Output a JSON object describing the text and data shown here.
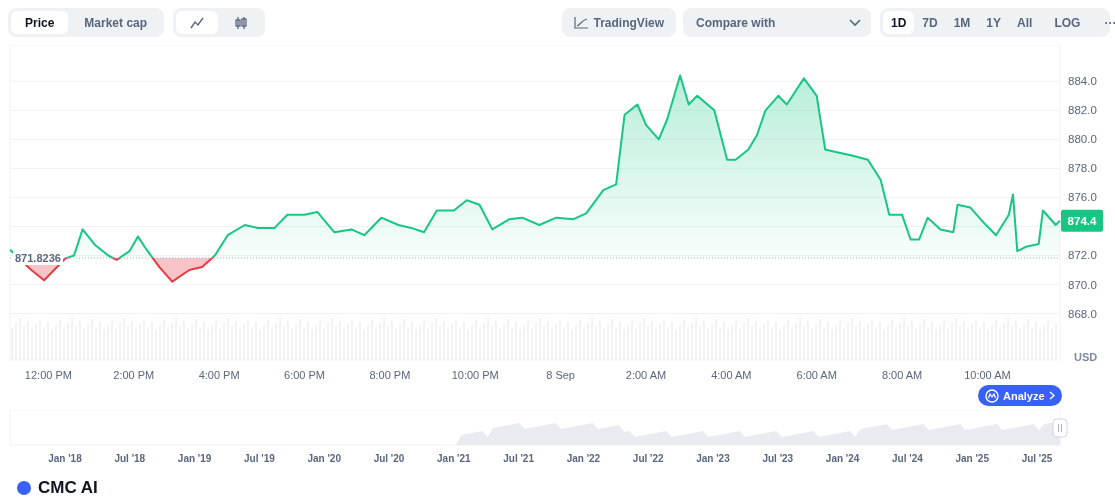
{
  "tabs": [
    {
      "label": "Price",
      "selected": true
    },
    {
      "label": "Market cap",
      "selected": false
    }
  ],
  "chart_types": [
    {
      "kind": "line",
      "selected": true
    },
    {
      "kind": "candle",
      "selected": false
    }
  ],
  "tradingview": {
    "label": "TradingView"
  },
  "compare": {
    "placeholder": "Compare with"
  },
  "ranges": [
    {
      "label": "1D",
      "selected": true
    },
    {
      "label": "7D",
      "selected": false
    },
    {
      "label": "1M",
      "selected": false
    },
    {
      "label": "1Y",
      "selected": false
    },
    {
      "label": "All",
      "selected": false
    }
  ],
  "scale_button": "LOG",
  "more_button": "···",
  "chart": {
    "current_price": "874.4",
    "unit": "USD",
    "chart_data": {
      "type": "area",
      "grid": true,
      "xlim": [
        "2025-09-07T11:06",
        "2025-09-08T11:42"
      ],
      "ylim": [
        864.8,
        886.5
      ],
      "xticks": [
        {
          "value": "2025-09-07T12:00",
          "label": "12:00 PM"
        },
        {
          "value": "2025-09-07T14:00",
          "label": "2:00 PM"
        },
        {
          "value": "2025-09-07T16:00",
          "label": "4:00 PM"
        },
        {
          "value": "2025-09-07T18:00",
          "label": "6:00 PM"
        },
        {
          "value": "2025-09-07T20:00",
          "label": "8:00 PM"
        },
        {
          "value": "2025-09-07T22:00",
          "label": "10:00 PM"
        },
        {
          "value": "2025-09-08T00:00",
          "label": "8 Sep"
        },
        {
          "value": "2025-09-08T02:00",
          "label": "2:00 AM"
        },
        {
          "value": "2025-09-08T04:00",
          "label": "4:00 AM"
        },
        {
          "value": "2025-09-08T06:00",
          "label": "6:00 AM"
        },
        {
          "value": "2025-09-08T08:00",
          "label": "8:00 AM"
        },
        {
          "value": "2025-09-08T10:00",
          "label": "10:00 AM"
        }
      ],
      "yticks": [
        {
          "value": 868,
          "label": "868.0"
        },
        {
          "value": 870,
          "label": "870.0"
        },
        {
          "value": 872,
          "label": "872.0"
        },
        {
          "value": 876,
          "label": "876.0"
        },
        {
          "value": 878,
          "label": "878.0"
        },
        {
          "value": 880,
          "label": "880.0"
        },
        {
          "value": 882,
          "label": "882.0"
        },
        {
          "value": 884,
          "label": "884.0"
        }
      ],
      "ref_lines": [
        {
          "axis": "y",
          "value": 871.8236,
          "label": "871.8236"
        }
      ],
      "x": [
        "2025-09-07T11:06",
        "2025-09-07T11:36",
        "2025-09-07T11:54",
        "2025-09-07T12:06",
        "2025-09-07T12:24",
        "2025-09-07T12:36",
        "2025-09-07T12:48",
        "2025-09-07T13:06",
        "2025-09-07T13:24",
        "2025-09-07T13:36",
        "2025-09-07T13:54",
        "2025-09-07T14:06",
        "2025-09-07T14:18",
        "2025-09-07T14:36",
        "2025-09-07T14:54",
        "2025-09-07T15:18",
        "2025-09-07T15:36",
        "2025-09-07T15:54",
        "2025-09-07T16:12",
        "2025-09-07T16:36",
        "2025-09-07T16:54",
        "2025-09-07T17:18",
        "2025-09-07T17:36",
        "2025-09-07T18:00",
        "2025-09-07T18:18",
        "2025-09-07T18:42",
        "2025-09-07T19:06",
        "2025-09-07T19:24",
        "2025-09-07T19:48",
        "2025-09-07T20:12",
        "2025-09-07T20:30",
        "2025-09-07T20:48",
        "2025-09-07T21:06",
        "2025-09-07T21:30",
        "2025-09-07T21:48",
        "2025-09-07T22:06",
        "2025-09-07T22:24",
        "2025-09-07T22:48",
        "2025-09-07T23:06",
        "2025-09-07T23:30",
        "2025-09-07T23:54",
        "2025-09-08T00:18",
        "2025-09-08T00:36",
        "2025-09-08T01:00",
        "2025-09-08T01:18",
        "2025-09-08T01:30",
        "2025-09-08T01:48",
        "2025-09-08T02:00",
        "2025-09-08T02:18",
        "2025-09-08T02:30",
        "2025-09-08T02:48",
        "2025-09-08T03:00",
        "2025-09-08T03:12",
        "2025-09-08T03:36",
        "2025-09-08T03:54",
        "2025-09-08T04:06",
        "2025-09-08T04:24",
        "2025-09-08T04:36",
        "2025-09-08T04:48",
        "2025-09-08T05:06",
        "2025-09-08T05:18",
        "2025-09-08T05:42",
        "2025-09-08T06:00",
        "2025-09-08T06:12",
        "2025-09-08T06:30",
        "2025-09-08T06:48",
        "2025-09-08T07:12",
        "2025-09-08T07:30",
        "2025-09-08T07:42",
        "2025-09-08T08:00",
        "2025-09-08T08:12",
        "2025-09-08T08:24",
        "2025-09-08T08:36",
        "2025-09-08T08:54",
        "2025-09-08T09:12",
        "2025-09-08T09:18",
        "2025-09-08T09:36",
        "2025-09-08T09:54",
        "2025-09-08T10:12",
        "2025-09-08T10:30",
        "2025-09-08T10:36",
        "2025-09-08T10:42",
        "2025-09-08T10:54",
        "2025-09-08T11:12",
        "2025-09-08T11:18",
        "2025-09-08T11:36",
        "2025-09-08T11:42"
      ],
      "series": [
        {
          "color": "#16c784",
          "values": [
            872.4,
            871.0,
            870.3,
            870.9,
            871.8,
            872.0,
            873.8,
            872.7,
            872.0,
            871.7,
            872.3,
            873.3,
            872.4,
            871.2,
            870.2,
            871.0,
            871.2,
            872.0,
            873.4,
            874.1,
            873.9,
            873.9,
            874.8,
            874.8,
            875.0,
            873.6,
            873.8,
            873.4,
            874.6,
            874.1,
            873.9,
            873.6,
            875.1,
            875.1,
            875.8,
            875.5,
            873.8,
            874.5,
            874.6,
            874.1,
            874.6,
            874.5,
            874.9,
            876.5,
            876.9,
            881.7,
            882.4,
            881.0,
            880.0,
            881.4,
            884.4,
            882.4,
            883.0,
            882.0,
            878.6,
            878.6,
            879.3,
            880.3,
            882.0,
            883.0,
            882.4,
            884.2,
            883.0,
            879.3,
            879.1,
            878.9,
            878.6,
            877.2,
            874.8,
            874.8,
            873.1,
            873.1,
            874.6,
            873.8,
            873.6,
            875.5,
            875.3,
            874.3,
            873.4,
            874.8,
            876.2,
            872.3,
            872.6,
            872.8,
            875.1,
            874.1,
            874.4
          ]
        }
      ]
    }
  },
  "analyze_button": "Analyze",
  "navigator": {
    "labels": [
      "Jan '18",
      "Jul '18",
      "Jan '19",
      "Jul '19",
      "Jan '20",
      "Jul '20",
      "Jan '21",
      "Jul '21",
      "Jan '22",
      "Jul '22",
      "Jan '23",
      "Jul '23",
      "Jan '24",
      "Jul '24",
      "Jan '25",
      "Jul '25"
    ]
  },
  "section_title": "CMC AI"
}
